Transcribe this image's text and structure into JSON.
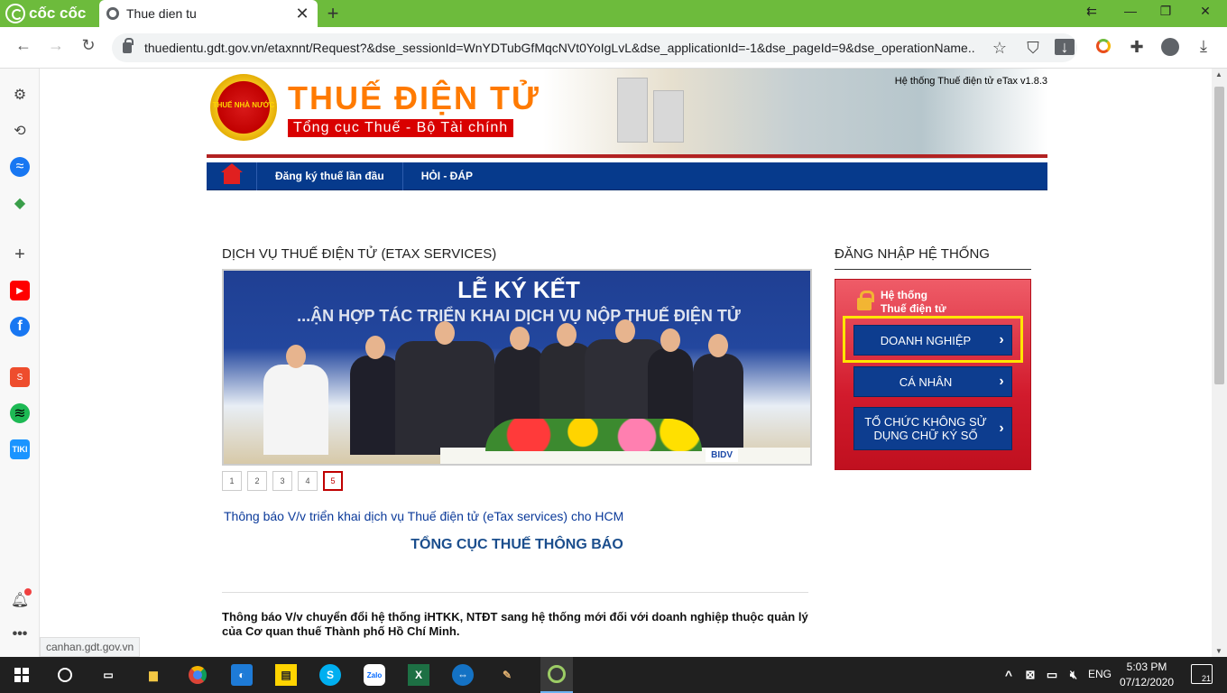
{
  "browser": {
    "brand": "cốc cốc",
    "tab_title": "Thue dien tu",
    "url": "thuedientu.gdt.gov.vn/etaxnnt/Request?&dse_sessionId=WnYDTubGfMqcNVt0YoIgLvL&dse_applicationId=-1&dse_pageId=9&dse_operationName...",
    "status_hint": "canhan.gdt.gov.vn"
  },
  "banner": {
    "emblem_text": "THUẾ NHÀ NƯỚC",
    "title": "THUẾ ĐIỆN TỬ",
    "subtitle": "Tổng cục Thuế - Bộ Tài chính",
    "version": "Hệ thống Thuế điện tử eTax v1.8.3"
  },
  "menu": {
    "items": [
      {
        "label": "Đăng ký thuế lần đầu"
      },
      {
        "label": "HỎI - ĐÁP"
      }
    ]
  },
  "services": {
    "title": "DỊCH VỤ THUẾ ĐIỆN TỬ (ETAX SERVICES)",
    "slide_heading": "LỄ KÝ KẾT",
    "slide_subheading": "...ẬN HỢP TÁC TRIỂN KHAI DỊCH VỤ NỘP THUẾ ĐIỆN TỬ",
    "slide_logo": "BIDV",
    "pages": [
      "1",
      "2",
      "3",
      "4",
      "5"
    ],
    "active_page": "5"
  },
  "notice": {
    "link": "Thông báo V/v triển khai dịch vụ Thuế điện tử (eTax services) cho HCM",
    "heading": "TỔNG CỤC THUẾ THÔNG BÁO",
    "body": "Thông báo V/v chuyển đổi hệ thống iHTKK, NTĐT sang hệ thống mới đối với doanh nghiệp thuộc quản lý của Cơ quan thuế Thành phố Hồ Chí Minh."
  },
  "login": {
    "title": "ĐĂNG NHẬP HỆ THỐNG",
    "header_line1": "Hệ thống",
    "header_line2": "Thuế điện tử",
    "buttons": [
      {
        "label": "DOANH NGHIỆP"
      },
      {
        "label": "CÁ NHÂN"
      },
      {
        "label": "TỔ CHỨC KHÔNG SỬ DỤNG CHỮ KÝ SỐ"
      }
    ]
  },
  "taskbar": {
    "language": "ENG",
    "time": "5:03 PM",
    "date": "07/12/2020",
    "notifications": "21"
  },
  "colors": {
    "browser_green": "#6dbb3c",
    "menu_blue": "#063a8c",
    "login_red": "#d21b2d",
    "button_blue": "#0d3d8f",
    "highlight_yellow": "#ffe500"
  }
}
